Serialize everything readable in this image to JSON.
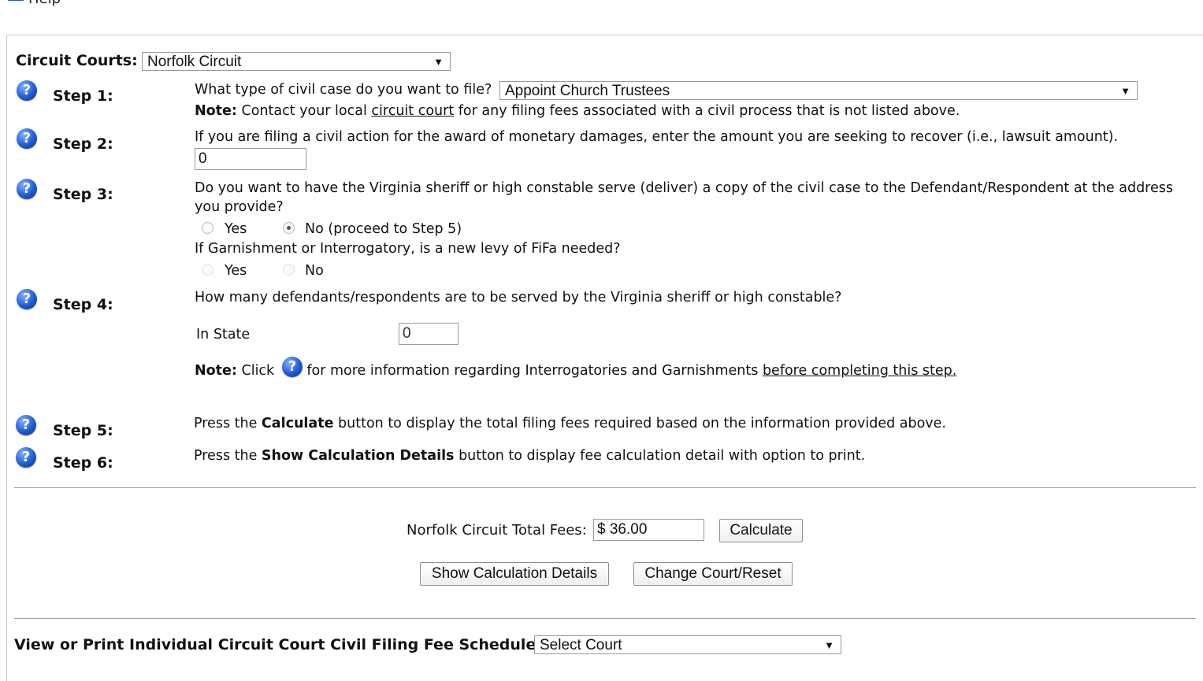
{
  "top": {
    "help_label": "Help"
  },
  "court": {
    "label": "Circuit Courts:",
    "selected": "Norfolk Circuit"
  },
  "step1": {
    "label": "Step 1:",
    "question": "What type of civil case do you want to file?",
    "selected_case": "Appoint Church Trustees",
    "note_label": "Note:",
    "note_text_a": "Contact your local",
    "note_link": "circuit court",
    "note_text_b": "for any filing fees associated with a civil process that is not listed above."
  },
  "step2": {
    "label": "Step 2:",
    "question": "If you are filing a civil action for the award of monetary damages, enter the amount you are seeking to recover (i.e., lawsuit amount).",
    "amount_value": "0"
  },
  "step3": {
    "label": "Step 3:",
    "question_line1": "Do you want to have the Virginia sheriff or high constable serve (deliver) a copy of the civil case to the Defendant/Respondent at the address",
    "question_line2": "you provide?",
    "yes_label": "Yes",
    "no_label": "No (proceed to Step 5)",
    "selected": "No",
    "levy_question": "If Garnishment or Interrogatory, is a new levy of FiFa needed?",
    "levy_yes_label": "Yes",
    "levy_no_label": "No"
  },
  "step4": {
    "label": "Step 4:",
    "question": "How many defendants/respondents are to be served by the Virginia sheriff or high constable?",
    "in_state_label": "In State",
    "in_state_value": "0",
    "note_label": "Note:",
    "note_click": "Click",
    "note_text": "for more information regarding Interrogatories and Garnishments",
    "note_link": "before completing this step."
  },
  "step5": {
    "label": "Step 5:",
    "text_a": "Press the",
    "text_bold": "Calculate",
    "text_b": "button to display the total filing fees required based on the information provided above."
  },
  "step6": {
    "label": "Step 6:",
    "text_a": "Press the",
    "text_bold": "Show Calculation Details",
    "text_b": "button to display fee calculation detail with option to print."
  },
  "totals": {
    "label": "Norfolk Circuit Total Fees:",
    "value": "$ 36.00",
    "calculate_button": "Calculate",
    "details_button": "Show Calculation Details",
    "reset_button": "Change Court/Reset"
  },
  "schedule": {
    "label": "View or Print Individual Circuit Court Civil Filing Fee Schedule:",
    "selected": "Select Court"
  },
  "icons": {
    "help": "help-question-icon",
    "dropdown": "chevron-down-icon"
  },
  "colors": {
    "help_icon": "#1f5bd6"
  }
}
